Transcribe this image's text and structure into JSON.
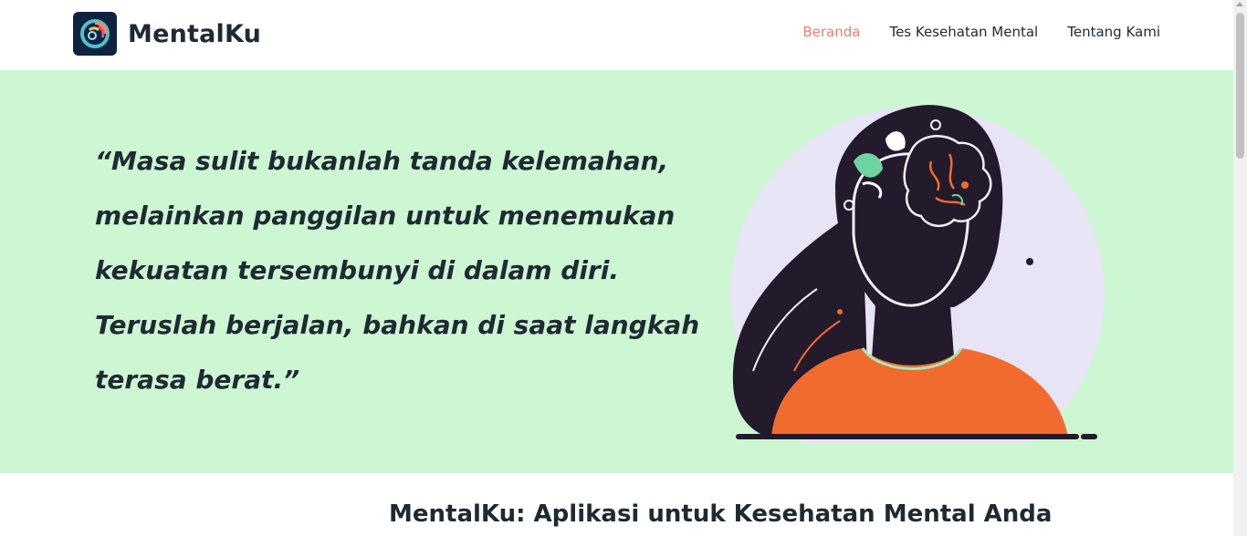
{
  "brand": {
    "name": "MentalKu",
    "logo_icon": "brain-swirl-icon"
  },
  "nav": {
    "items": [
      {
        "label": "Beranda",
        "active": true
      },
      {
        "label": "Tes Kesehatan Mental",
        "active": false
      },
      {
        "label": "Tentang Kami",
        "active": false
      }
    ]
  },
  "hero": {
    "quote": "“Masa sulit bukanlah tanda kelemahan, melainkan panggilan untuk menemukan kekuatan tersembunyi di dalam diri. Teruslah berjalan, bahkan di saat langkah terasa berat.”",
    "illustration_icon": "woman-mind-illustration"
  },
  "section": {
    "title": "MentalKu: Aplikasi untuk Kesehatan Mental Anda"
  },
  "colors": {
    "accent": "#f07c72",
    "hero_bg": "#cdf6d3",
    "text_dark": "#1e2a32",
    "shirt_orange": "#f26b2e",
    "circle_lavender": "#e6e4f5"
  }
}
